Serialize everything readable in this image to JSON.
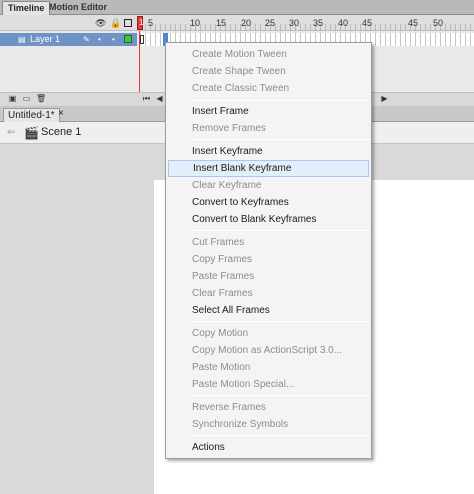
{
  "panel_tabs": [
    "Timeline",
    "Motion Editor"
  ],
  "timeline": {
    "header_icons": [
      "eye-icon",
      "lock-icon",
      "outline-icon"
    ],
    "ruler_numbers": [
      "1",
      "5",
      "10",
      "15",
      "20",
      "25",
      "30",
      "35",
      "40",
      "45",
      "50"
    ],
    "layer": {
      "name": "Layer 1",
      "outline_color": "#3cc83c"
    }
  },
  "document": {
    "tab_name": "Untitled-1*",
    "close_glyph": "×",
    "scene_label": "Scene 1"
  },
  "context_menu": {
    "items": [
      {
        "label": "Create Motion Tween",
        "enabled": false
      },
      {
        "label": "Create Shape Tween",
        "enabled": false
      },
      {
        "label": "Create Classic Tween",
        "enabled": false
      },
      {
        "label": "Insert Frame",
        "enabled": true
      },
      {
        "label": "Remove Frames",
        "enabled": false
      },
      {
        "label": "Insert Keyframe",
        "enabled": true
      },
      {
        "label": "Insert Blank Keyframe",
        "enabled": true,
        "highlighted": true
      },
      {
        "label": "Clear Keyframe",
        "enabled": false
      },
      {
        "label": "Convert to Keyframes",
        "enabled": true
      },
      {
        "label": "Convert to Blank Keyframes",
        "enabled": true
      },
      {
        "label": "Cut Frames",
        "enabled": false
      },
      {
        "label": "Copy Frames",
        "enabled": false
      },
      {
        "label": "Paste Frames",
        "enabled": false
      },
      {
        "label": "Clear Frames",
        "enabled": false
      },
      {
        "label": "Select All Frames",
        "enabled": true
      },
      {
        "label": "Copy Motion",
        "enabled": false
      },
      {
        "label": "Copy Motion as ActionScript 3.0...",
        "enabled": false
      },
      {
        "label": "Paste Motion",
        "enabled": false
      },
      {
        "label": "Paste Motion Special...",
        "enabled": false
      },
      {
        "label": "Reverse Frames",
        "enabled": false
      },
      {
        "label": "Synchronize Symbols",
        "enabled": false
      },
      {
        "label": "Actions",
        "enabled": true
      }
    ]
  },
  "colors": {
    "layer_selected": "#6f93c6",
    "playhead": "#e23b3b",
    "menu_highlight": "#e3eefb"
  }
}
